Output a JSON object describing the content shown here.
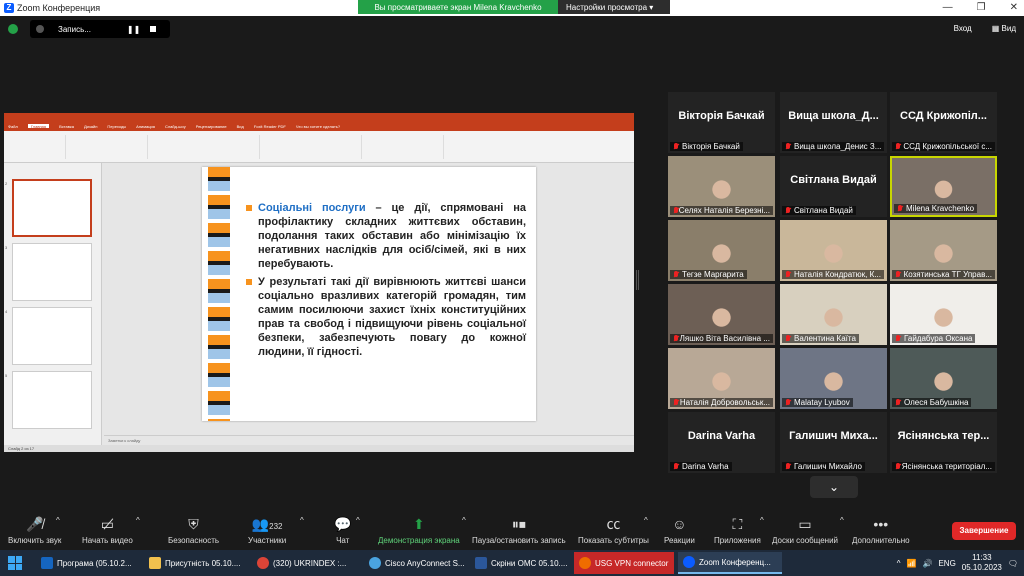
{
  "window": {
    "title": "Zoom Конференция",
    "share_msg": "Вы просматриваете экран Milena Kravchenko",
    "share_opt": "Настройки просмотра",
    "rec_label": "Запись..."
  },
  "topright": {
    "enter": "Вход",
    "view": "Вид"
  },
  "presentation": {
    "ribbon_tabs": [
      "Файл",
      "Главная",
      "Вставка",
      "Дизайн",
      "Переходы",
      "Анимация",
      "Слайд-шоу",
      "Рецензирование",
      "Вид",
      "Foxit Reader PDF",
      "Что вы хотите сделать?"
    ],
    "bullets": [
      {
        "highlight": "Соціальні послуги",
        "text": " – це дії, спрямовані на профілактику складних життєвих обставин, подолання таких обставин або мінімізацію їх негативних наслідків для осіб/сімей, які в них перебувають."
      },
      {
        "highlight": "",
        "text": "У результаті такі дії вирівнюють життєві шанси соціально вразливих категорій громадян, тим самим посилюючи захист їхніх конституційних прав та свобод і підвищуючи рівень соціальної безпеки, забезпечують повагу до кожної людини, її гідності."
      }
    ],
    "notes": "Заметки к слайду",
    "status": "Слайд 2 из 17"
  },
  "participants": [
    {
      "name": "Вікторія Бачкай",
      "label": "Вікторія Бачкай",
      "video": false
    },
    {
      "name": "Вища школа_Д...",
      "label": "Вища школа_Денис З...",
      "video": false
    },
    {
      "name": "ССД Крижопіл...",
      "label": "ССД Крижопільської с...",
      "video": false
    },
    {
      "name": "",
      "label": "Селях Наталія Березні...",
      "video": true,
      "bg": "#9b8f7a"
    },
    {
      "name": "Світлана Видай",
      "label": "Світлана Видай",
      "video": false
    },
    {
      "name": "",
      "label": "Milena Kravchenko",
      "video": true,
      "bg": "#7a6f66",
      "active": true
    },
    {
      "name": "",
      "label": "Тегзе Маргарита",
      "video": true,
      "bg": "#8a7e6a"
    },
    {
      "name": "",
      "label": "Наталія Кондратюк, К...",
      "video": true,
      "bg": "#c9b79a"
    },
    {
      "name": "",
      "label": "Козятинська ТГ Управ...",
      "video": true,
      "bg": "#a59a86"
    },
    {
      "name": "",
      "label": "Ляшко Віта Василівна ...",
      "video": true,
      "bg": "#6d5f55"
    },
    {
      "name": "",
      "label": "Валентина Каїта",
      "video": true,
      "bg": "#d8d0bf"
    },
    {
      "name": "",
      "label": "Гайдабура Оксана",
      "video": true,
      "bg": "#f0eeea"
    },
    {
      "name": "",
      "label": "Наталія Добровольськ...",
      "video": true,
      "bg": "#b8a896"
    },
    {
      "name": "",
      "label": "Malatay Lyubov",
      "video": true,
      "bg": "#6e7585"
    },
    {
      "name": "",
      "label": "Олеся Бабушкіна",
      "video": true,
      "bg": "#4e5a58"
    },
    {
      "name": "Darina Varha",
      "label": "Darina Varha",
      "video": false
    },
    {
      "name": "Галишич Миха...",
      "label": "Галишич Михайло",
      "video": false
    },
    {
      "name": "Ясінянська тер...",
      "label": "Ясінянська територіал...",
      "video": false
    }
  ],
  "toolbar": {
    "mute": "Включить звук",
    "video": "Начать видео",
    "security": "Безопасность",
    "participants": "Участники",
    "participants_count": "232",
    "chat": "Чат",
    "share": "Демонстрация экрана",
    "record": "Пауза/остановить запись",
    "subtitles": "Показать субтитры",
    "reactions": "Реакции",
    "apps": "Приложения",
    "boards": "Доски сообщений",
    "more": "Дополнительно",
    "end": "Завершение"
  },
  "taskbar": {
    "items": [
      "Програма (05.10.2...",
      "Присутність 05.10....",
      "(320) UKRINDEX :...",
      "Cisco AnyConnect S...",
      "Скріни ОМС 05.10....",
      "USG VPN connector",
      "Zoom Конференц..."
    ],
    "lang": "ENG",
    "time": "11:33",
    "date": "05.10.2023"
  }
}
